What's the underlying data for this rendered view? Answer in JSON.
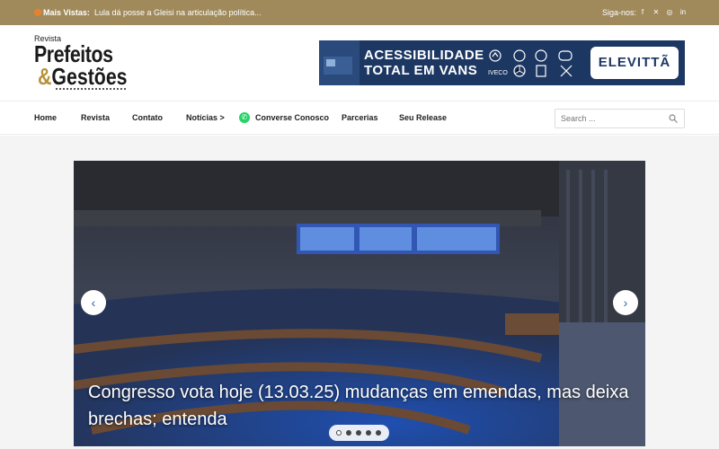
{
  "topbar": {
    "most_viewed_label": "Mais Vistas:",
    "headline": "Lula dá posse a Gleisi na articulação política...",
    "follow_label": "Siga-nos:"
  },
  "logo": {
    "small": "Revista",
    "line1": "Prefeitos",
    "amp": "&",
    "line2": "Gestões"
  },
  "banner": {
    "line1": "ACESSIBILIDADE",
    "line2": "TOTAL EM VANS",
    "brand": "ELEVITTÃ"
  },
  "nav": {
    "items": [
      "Home",
      "Revista",
      "Contato",
      "Notícias >",
      "Converse Conosco",
      "Parcerias",
      "Seu Release"
    ],
    "search_placeholder": "Search ..."
  },
  "slider": {
    "caption": "Congresso vota hoje (13.03.25) mudanças em emendas, mas deixa brechas; entenda",
    "slide_count": 5,
    "active_slide": 1
  },
  "colors": {
    "topbar": "#a08a5c",
    "banner": "#1d3763",
    "accent": "#2a5eb6"
  }
}
